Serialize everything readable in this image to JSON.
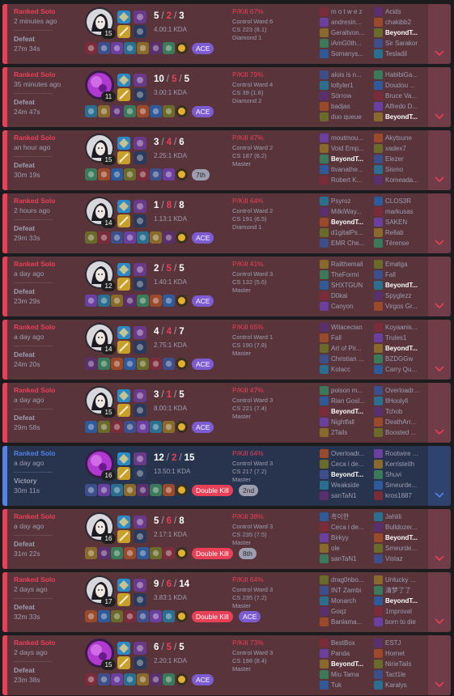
{
  "colors": {
    "loss_bg": "#59343b",
    "win_bg": "#28344e",
    "loss_accent": "#e84057",
    "win_accent": "#5383e8",
    "ace": "#7c5cd0"
  },
  "matches": [
    {
      "outcome": "loss",
      "queue": "Ranked Solo",
      "time": "2 minutes ago",
      "result": "Defeat",
      "duration": "27m 34s",
      "champion": "moon-champion",
      "level": "15",
      "kills": "5",
      "deaths": "2",
      "assists": "3",
      "kda_ratio": "4.00:1 KDA",
      "badges": [
        {
          "type": "ace",
          "label": "ACE"
        }
      ],
      "pkill": "P/Kill 67%",
      "control_ward": "Control Ward 6",
      "cs": "CS 223 (8.1)",
      "rank": "Diamond 1",
      "team1": [
        "m o t w e z",
        "andresin...",
        "Geraltvon...",
        "iAmG0th...",
        "Somanys..."
      ],
      "team2": [
        "Acids",
        "chakibb2",
        "BeyondT...",
        "Sir Sarakor",
        "TesladiI"
      ],
      "me_team": 2,
      "me_index": 2
    },
    {
      "outcome": "loss",
      "queue": "Ranked Solo",
      "time": "35 minutes ago",
      "result": "Defeat",
      "duration": "24m 47s",
      "champion": "purple-champion",
      "level": "11",
      "kills": "10",
      "deaths": "5",
      "assists": "5",
      "kda_ratio": "3.00:1 KDA",
      "badges": [
        {
          "type": "ace",
          "label": "ACE"
        }
      ],
      "pkill": "P/Kill 79%",
      "control_ward": "Control Ward 4",
      "cs": "CS 39 (1.6)",
      "rank": "Diamond 2",
      "team1": [
        "alois is n...",
        "loltyler1",
        "Sörrow",
        "badjas",
        "duo queue"
      ],
      "team2": [
        "HabibiGa...",
        "Doudou ...",
        "Bruce Va...",
        "Alfredo D...",
        "BeyondT..."
      ],
      "me_team": 2,
      "me_index": 4
    },
    {
      "outcome": "loss",
      "queue": "Ranked Solo",
      "time": "an hour ago",
      "result": "Defeat",
      "duration": "30m 19s",
      "champion": "moon-champion",
      "level": "15",
      "kills": "3",
      "deaths": "4",
      "assists": "6",
      "kda_ratio": "2.25:1 KDA",
      "badges": [
        {
          "type": "pos",
          "label": "7th"
        }
      ],
      "pkill": "P/Kill 47%",
      "control_ward": "Control Ward 2",
      "cs": "CS 187 (6.2)",
      "rank": "Master",
      "team1": [
        "moutmou...",
        "Void Emp...",
        "BeyondT...",
        "ttvanathe...",
        "Robert K..."
      ],
      "team2": [
        "Akytsune",
        "xadex7",
        "Elezer",
        "Sismo",
        "Komeada..."
      ],
      "me_team": 1,
      "me_index": 2
    },
    {
      "outcome": "loss",
      "queue": "Ranked Solo",
      "time": "2 hours ago",
      "result": "Defeat",
      "duration": "29m 33s",
      "champion": "moon-champion",
      "level": "14",
      "kills": "1",
      "deaths": "8",
      "assists": "8",
      "kda_ratio": "1.13:1 KDA",
      "badges": [
        {
          "type": "ace",
          "label": "ACE"
        }
      ],
      "pkill": "P/Kill 64%",
      "control_ward": "Control Ward 2",
      "cs": "CS 191 (6.5)",
      "rank": "Diamond 1",
      "team1": [
        "Psyroz",
        "MilkiWay...",
        "BeyondT...",
        "d1gitalPs...",
        "EMR Che..."
      ],
      "team2": [
        "CLOS3R",
        "markusas",
        "SAKEN",
        "Rellab",
        "Térense"
      ],
      "me_team": 1,
      "me_index": 2
    },
    {
      "outcome": "loss",
      "queue": "Ranked Solo",
      "time": "a day ago",
      "result": "Defeat",
      "duration": "23m 29s",
      "champion": "moon-champion",
      "level": "12",
      "kills": "2",
      "deaths": "5",
      "assists": "5",
      "kda_ratio": "1.40:1 KDA",
      "badges": [
        {
          "type": "ace",
          "label": "ACE"
        }
      ],
      "pkill": "P/Kill 41%",
      "control_ward": "Control Ward 3",
      "cs": "CS 132 (5.6)",
      "rank": "Master",
      "team1": [
        "Railthemail",
        "TheFormi",
        "SHXTGUN",
        "D0kai",
        "Canyon"
      ],
      "team2": [
        "Emølga",
        "Fall",
        "BeyondT...",
        "Spyglezz",
        "Virgos Gr..."
      ],
      "me_team": 2,
      "me_index": 2
    },
    {
      "outcome": "loss",
      "queue": "Ranked Solo",
      "time": "a day ago",
      "result": "Defeat",
      "duration": "24m 20s",
      "champion": "moon-champion",
      "level": "14",
      "kills": "4",
      "deaths": "4",
      "assists": "7",
      "kda_ratio": "2.75:1 KDA",
      "badges": [
        {
          "type": "ace",
          "label": "ACE"
        }
      ],
      "pkill": "P/Kill 65%",
      "control_ward": "Control Ward 1",
      "cs": "CS 190 (7.8)",
      "rank": "Master",
      "team1": [
        "Wilacecian",
        "Fall",
        "Art of Pir...",
        "Christian ...",
        "Kolacc"
      ],
      "team2": [
        "Koyaanis...",
        "Trules1",
        "BeyondT...",
        "BZDGGw",
        "Carry Qu..."
      ],
      "me_team": 2,
      "me_index": 2
    },
    {
      "outcome": "loss",
      "queue": "Ranked Solo",
      "time": "a day ago",
      "result": "Defeat",
      "duration": "29m 58s",
      "champion": "moon-champion",
      "level": "15",
      "kills": "3",
      "deaths": "1",
      "assists": "5",
      "kda_ratio": "8.00:1 KDA",
      "badges": [
        {
          "type": "ace",
          "label": "ACE"
        }
      ],
      "pkill": "P/Kill 47%",
      "control_ward": "Control Ward 3",
      "cs": "CS 221 (7.4)",
      "rank": "Master",
      "team1": [
        "poison m...",
        "Rian Gosl...",
        "BeyondT...",
        "Nightfall",
        "2Tails"
      ],
      "team2": [
        "Overloadr...",
        "IlHoolyll",
        "Tchob",
        "DeathArr...",
        "Boosted ..."
      ],
      "me_team": 1,
      "me_index": 2
    },
    {
      "outcome": "win",
      "queue": "Ranked Solo",
      "time": "a day ago",
      "result": "Victory",
      "duration": "30m 11s",
      "champion": "purple-champion",
      "level": "16",
      "kills": "12",
      "deaths": "2",
      "assists": "15",
      "kda_ratio": "13.50:1 KDA",
      "badges": [
        {
          "type": "mk",
          "label": "Double Kill"
        },
        {
          "type": "pos",
          "label": "2nd"
        }
      ],
      "pkill": "P/Kill 64%",
      "control_ward": "Control Ward 3",
      "cs": "CS 217 (7.2)",
      "rank": "Master",
      "team1": [
        "Overloadr...",
        "Ceca i de...",
        "BeyondT...",
        "Weakside",
        "sanTaN1"
      ],
      "team2": [
        "Rootwire ...",
        "Kerristeith",
        "Shuvi",
        "Smeurde...",
        "kros1887"
      ],
      "me_team": 1,
      "me_index": 2
    },
    {
      "outcome": "loss",
      "queue": "Ranked Solo",
      "time": "a day ago",
      "result": "Defeat",
      "duration": "31m 22s",
      "champion": "moon-champion",
      "level": "16",
      "kills": "5",
      "deaths": "6",
      "assists": "8",
      "kda_ratio": "2.17:1 KDA",
      "badges": [
        {
          "type": "mk",
          "label": "Double Kill"
        },
        {
          "type": "pos",
          "label": "8th"
        }
      ],
      "pkill": "P/Kill 38%",
      "control_ward": "Control Ward 3",
      "cs": "CS 235 (7.5)",
      "rank": "Master",
      "team1": [
        "흑이한",
        "Ceca i de...",
        "Birkyy",
        "ole",
        "sanTaN1"
      ],
      "team2": [
        "Jahlili",
        "Bulldozer...",
        "BeyondT...",
        "Smeurde...",
        "Vistaz"
      ],
      "me_team": 2,
      "me_index": 2
    },
    {
      "outcome": "loss",
      "queue": "Ranked Solo",
      "time": "2 days ago",
      "result": "Defeat",
      "duration": "32m 33s",
      "champion": "moon-champion",
      "level": "17",
      "kills": "9",
      "deaths": "6",
      "assists": "14",
      "kda_ratio": "3.83:1 KDA",
      "badges": [
        {
          "type": "mk",
          "label": "Double Kill"
        },
        {
          "type": "ace",
          "label": "ACE"
        }
      ],
      "pkill": "P/Kill 64%",
      "control_ward": "Control Ward 3",
      "cs": "CS 235 (7.2)",
      "rank": "Master",
      "team1": [
        "drag0nbo...",
        "INT Zambi",
        "Monarch",
        "Goqz",
        "Banlama..."
      ],
      "team2": [
        "Unlucky ...",
        "清梦了了",
        "BeyondT...",
        "1mproval",
        "born to die"
      ],
      "me_team": 2,
      "me_index": 2
    },
    {
      "outcome": "loss",
      "queue": "Ranked Solo",
      "time": "2 days ago",
      "result": "Defeat",
      "duration": "23m 38s",
      "champion": "purple-champion",
      "level": "15",
      "kills": "6",
      "deaths": "5",
      "assists": "5",
      "kda_ratio": "2.20:1 KDA",
      "badges": [
        {
          "type": "ace",
          "label": "ACE"
        }
      ],
      "pkill": "P/Kill 73%",
      "control_ward": "Control Ward 3",
      "cs": "CS 198 (8.4)",
      "rank": "Master",
      "team1": [
        "BestBox",
        "Panda",
        "BeyondT...",
        "Miu Tama",
        "Tuk"
      ],
      "team2": [
        "ESTJ",
        "Hornet",
        "NirieTails",
        "Tact1le",
        "Karalys"
      ],
      "me_team": 1,
      "me_index": 2
    }
  ]
}
